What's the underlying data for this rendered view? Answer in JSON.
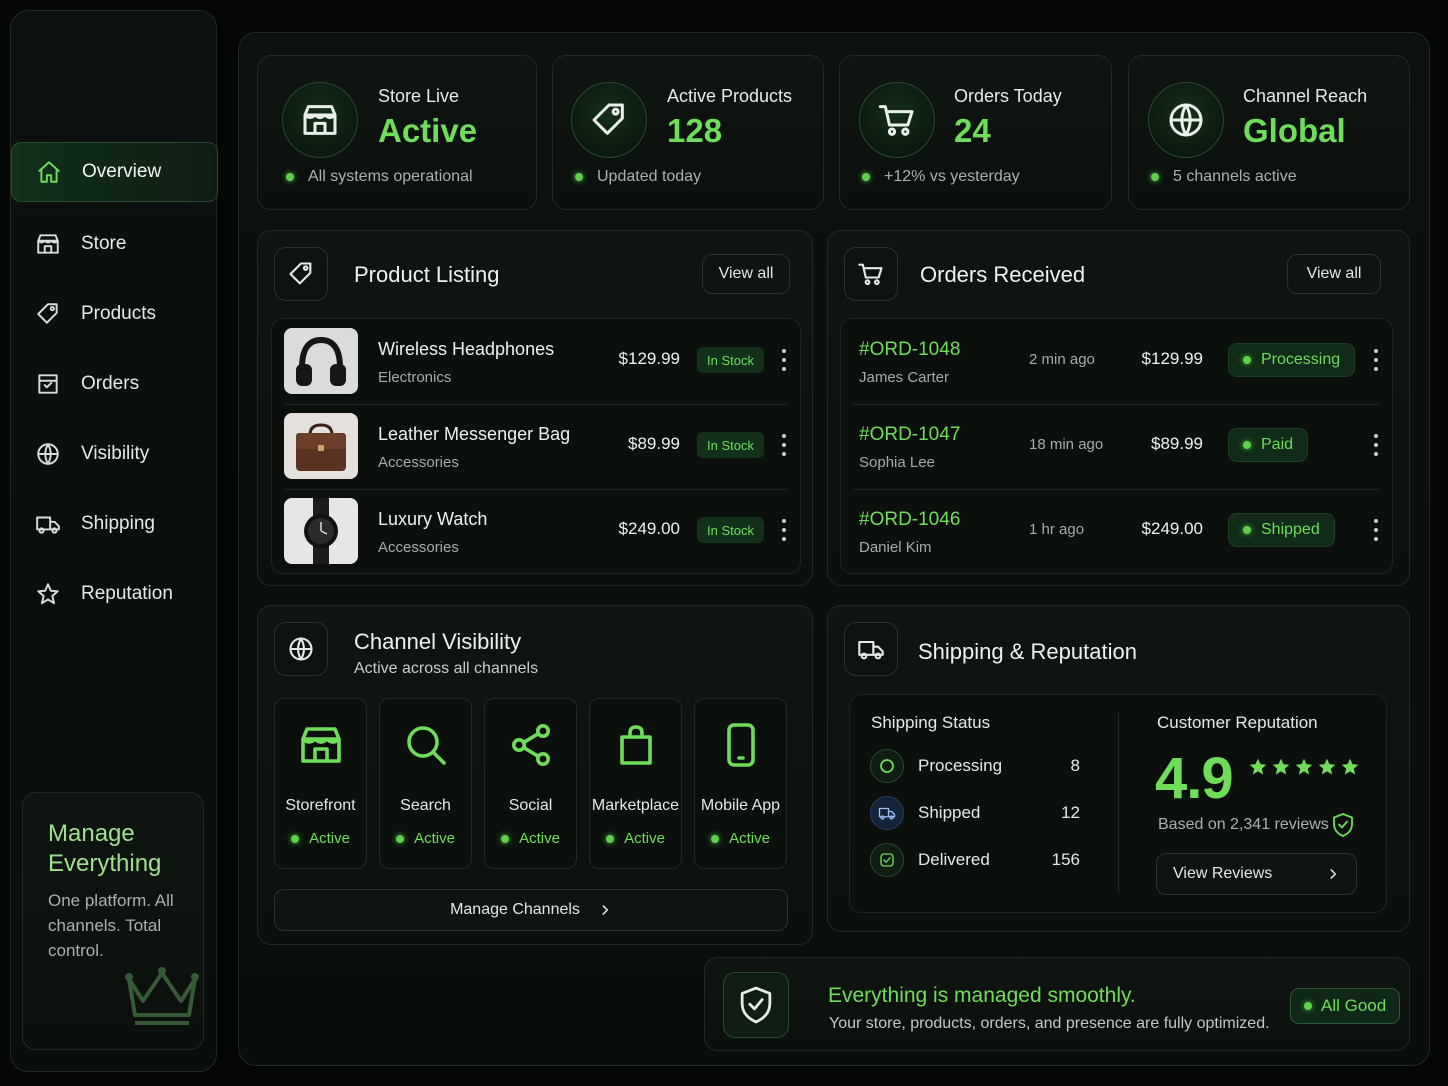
{
  "sidebar": {
    "items": [
      {
        "label": "Overview",
        "icon": "home-icon",
        "active": true
      },
      {
        "label": "Store",
        "icon": "store-icon"
      },
      {
        "label": "Products",
        "icon": "tag-icon"
      },
      {
        "label": "Orders",
        "icon": "orders-icon"
      },
      {
        "label": "Visibility",
        "icon": "globe-icon"
      },
      {
        "label": "Shipping",
        "icon": "truck-icon"
      },
      {
        "label": "Reputation",
        "icon": "star-icon"
      }
    ],
    "promo": {
      "title": "Manage Everything",
      "text": "One platform. All channels. Total control.",
      "icon": "crown-icon"
    }
  },
  "stats": [
    {
      "label": "Store Live",
      "value": "Active",
      "sub": "All systems operational",
      "icon": "store-icon"
    },
    {
      "label": "Active Products",
      "value": "128",
      "sub": "Updated today",
      "icon": "tag-icon"
    },
    {
      "label": "Orders Today",
      "value": "24",
      "sub": "+12% vs yesterday",
      "icon": "cart-icon"
    },
    {
      "label": "Channel Reach",
      "value": "Global",
      "sub": "5 channels active",
      "icon": "globe-icon"
    }
  ],
  "products": {
    "title": "Product Listing",
    "view_all": "View all",
    "items": [
      {
        "name": "Wireless Headphones",
        "category": "Electronics",
        "price": "$129.99",
        "status": "In Stock"
      },
      {
        "name": "Leather Messenger Bag",
        "category": "Accessories",
        "price": "$89.99",
        "status": "In Stock"
      },
      {
        "name": "Luxury Watch",
        "category": "Accessories",
        "price": "$249.00",
        "status": "In Stock"
      }
    ]
  },
  "orders": {
    "title": "Orders Received",
    "view_all": "View all",
    "items": [
      {
        "id": "#ORD-1048",
        "customer": "James Carter",
        "time": "2 min ago",
        "amount": "$129.99",
        "status": "Processing"
      },
      {
        "id": "#ORD-1047",
        "customer": "Sophia Lee",
        "time": "18 min ago",
        "amount": "$89.99",
        "status": "Paid"
      },
      {
        "id": "#ORD-1046",
        "customer": "Daniel Kim",
        "time": "1 hr ago",
        "amount": "$249.00",
        "status": "Shipped"
      }
    ]
  },
  "channels": {
    "title": "Channel Visibility",
    "subtitle": "Active across all channels",
    "items": [
      {
        "name": "Storefront",
        "status": "Active",
        "icon": "store-icon"
      },
      {
        "name": "Search",
        "status": "Active",
        "icon": "search-icon"
      },
      {
        "name": "Social",
        "status": "Active",
        "icon": "share-icon"
      },
      {
        "name": "Marketplace",
        "status": "Active",
        "icon": "bag-icon"
      },
      {
        "name": "Mobile App",
        "status": "Active",
        "icon": "phone-icon"
      }
    ],
    "manage": "Manage Channels"
  },
  "shipping": {
    "title": "Shipping & Reputation",
    "status_title": "Shipping Status",
    "rows": [
      {
        "label": "Processing",
        "value": "8"
      },
      {
        "label": "Shipped",
        "value": "12"
      },
      {
        "label": "Delivered",
        "value": "156"
      }
    ],
    "reputation": {
      "title": "Customer Reputation",
      "rating": "4.9",
      "stars": 5,
      "reviews": "Based on 2,341 reviews",
      "button": "View Reviews"
    }
  },
  "footer": {
    "headline": "Everything is managed smoothly.",
    "text": "Your store, products, orders, and presence are fully optimized.",
    "badge": "All Good"
  },
  "colors": {
    "accent": "#6fdc5a",
    "background": "#050706"
  }
}
